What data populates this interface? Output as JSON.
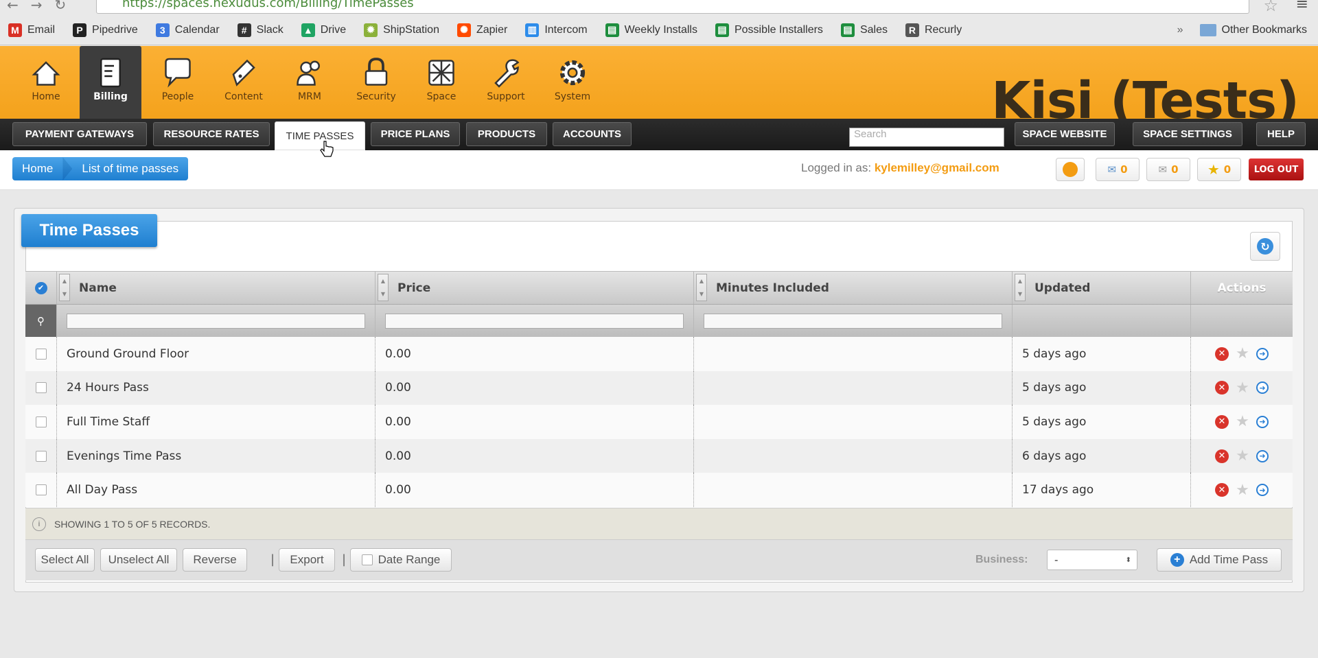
{
  "browser": {
    "url": "https://spaces.nexudus.com/Billing/TimePasses",
    "bookmarks": [
      {
        "label": "Email",
        "icon": "gmail-icon",
        "color": "#d93025",
        "glyph": "M"
      },
      {
        "label": "Pipedrive",
        "icon": "pipedrive-icon",
        "color": "#222222",
        "glyph": "P"
      },
      {
        "label": "Calendar",
        "icon": "calendar-icon",
        "color": "#3f7ae0",
        "glyph": "3"
      },
      {
        "label": "Slack",
        "icon": "slack-icon",
        "color": "#333333",
        "glyph": "#"
      },
      {
        "label": "Drive",
        "icon": "drive-icon",
        "color": "#1fa463",
        "glyph": "▲"
      },
      {
        "label": "ShipStation",
        "icon": "shipstation-icon",
        "color": "#8bb13a",
        "glyph": "✹"
      },
      {
        "label": "Zapier",
        "icon": "zapier-icon",
        "color": "#ff4a00",
        "glyph": "✺"
      },
      {
        "label": "Intercom",
        "icon": "intercom-icon",
        "color": "#2d8cea",
        "glyph": "▥"
      },
      {
        "label": "Weekly Installs",
        "icon": "sheets-icon",
        "color": "#1e8e3e",
        "glyph": "▤"
      },
      {
        "label": "Possible Installers",
        "icon": "sheets-icon",
        "color": "#1e8e3e",
        "glyph": "▤"
      },
      {
        "label": "Sales",
        "icon": "sheets-icon",
        "color": "#1e8e3e",
        "glyph": "▤"
      },
      {
        "label": "Recurly",
        "icon": "recurly-icon",
        "color": "#555555",
        "glyph": "R"
      }
    ],
    "more": "»",
    "other_bookmarks": "Other Bookmarks"
  },
  "modules": [
    {
      "label": "Home",
      "icon": "home-icon"
    },
    {
      "label": "Billing",
      "icon": "billing-icon",
      "active": true
    },
    {
      "label": "People",
      "icon": "people-icon"
    },
    {
      "label": "Content",
      "icon": "content-icon"
    },
    {
      "label": "MRM",
      "icon": "mrm-icon"
    },
    {
      "label": "Security",
      "icon": "lock-icon"
    },
    {
      "label": "Space",
      "icon": "space-icon"
    },
    {
      "label": "Support",
      "icon": "wrench-icon"
    },
    {
      "label": "System",
      "icon": "gear-icon"
    }
  ],
  "brand": "Kisi (Tests)",
  "subnav": {
    "items": [
      "PAYMENT GATEWAYS",
      "RESOURCE RATES",
      "TIME PASSES",
      "PRICE PLANS",
      "PRODUCTS",
      "ACCOUNTS"
    ],
    "active": "TIME PASSES",
    "search_placeholder": "Search",
    "right": [
      "SPACE WEBSITE",
      "SPACE SETTINGS",
      "HELP"
    ]
  },
  "breadcrumb": {
    "home": "Home",
    "current": "List of time passes"
  },
  "user": {
    "logged_label": "Logged in as:",
    "email": "kylemilley@gmail.com",
    "counts": {
      "messages": "0",
      "mail": "0",
      "favorites": "0"
    },
    "logout": "LOG OUT"
  },
  "panel": {
    "title": "Time Passes"
  },
  "table": {
    "columns": [
      "Name",
      "Price",
      "Minutes Included",
      "Updated",
      "Actions"
    ],
    "rows": [
      {
        "name": "Ground Ground Floor",
        "price": "0.00",
        "minutes": "",
        "updated": "5 days ago"
      },
      {
        "name": "24 Hours Pass",
        "price": "0.00",
        "minutes": "",
        "updated": "5 days ago"
      },
      {
        "name": "Full Time Staff",
        "price": "0.00",
        "minutes": "",
        "updated": "5 days ago"
      },
      {
        "name": "Evenings Time Pass",
        "price": "0.00",
        "minutes": "",
        "updated": "6 days ago"
      },
      {
        "name": "All Day Pass",
        "price": "0.00",
        "minutes": "",
        "updated": "17 days ago"
      }
    ],
    "footer": "SHOWING 1 TO 5 OF 5 RECORDS."
  },
  "toolbar": {
    "select_all": "Select All",
    "unselect_all": "Unselect All",
    "reverse": "Reverse",
    "export": "Export",
    "date_range": "Date Range",
    "business_label": "Business:",
    "business_value": "-",
    "add": "Add Time Pass"
  },
  "colors": {
    "header_orange": "#f9a82a",
    "accent_blue": "#1f7fd0",
    "logout_red": "#c0201a",
    "email_orange": "#f39c12"
  }
}
